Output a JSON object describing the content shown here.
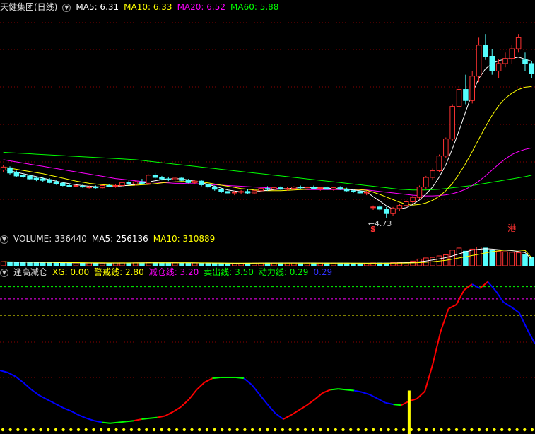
{
  "colors": {
    "up": "#ff3232",
    "down": "#54ffff",
    "ma5": "#ffffff",
    "ma10": "#ffff00",
    "ma20": "#ff00ff",
    "ma60": "#00ff00",
    "grid": "#8b0000",
    "xg_up": "#ff0000",
    "xg_down": "#0000ff",
    "xg_flat": "#00ff00"
  },
  "price_panel": {
    "title": "天健集团(日线)",
    "ma5": "MA5: 6.31",
    "ma10": "MA10: 6.33",
    "ma20": "MA20: 6.52",
    "ma60": "MA60: 5.88",
    "low_label": "←4.73",
    "marker_s": "S",
    "marker_gang": "港"
  },
  "volume_panel": {
    "volume": "VOLUME: 336440",
    "ma5": "MA5: 256136",
    "ma10": "MA10: 310889"
  },
  "indicator_panel": {
    "name": "逢高减仓",
    "xg": "XG: 0.00",
    "warn": "警戒线: 2.80",
    "reduce": "减仓线: 3.20",
    "sell": "卖出线: 3.50",
    "power": "动力线: 0.29",
    "extra": "0.29"
  },
  "chart_data": {
    "type": "candlestick",
    "title": "天健集团(日线)",
    "candles": [
      [
        6.02,
        6.15,
        5.96,
        6.1
      ],
      [
        6.08,
        6.12,
        5.9,
        5.94
      ],
      [
        5.96,
        6.0,
        5.82,
        5.86
      ],
      [
        5.88,
        5.94,
        5.8,
        5.84
      ],
      [
        5.86,
        5.9,
        5.76,
        5.78
      ],
      [
        5.8,
        5.84,
        5.72,
        5.76
      ],
      [
        5.78,
        5.82,
        5.7,
        5.74
      ],
      [
        5.76,
        5.8,
        5.66,
        5.68
      ],
      [
        5.7,
        5.74,
        5.62,
        5.64
      ],
      [
        5.66,
        5.7,
        5.58,
        5.6
      ],
      [
        5.6,
        5.66,
        5.56,
        5.58
      ],
      [
        5.58,
        5.64,
        5.54,
        5.6
      ],
      [
        5.58,
        5.62,
        5.54,
        5.56
      ],
      [
        5.56,
        5.6,
        5.52,
        5.56
      ],
      [
        5.56,
        5.6,
        5.52,
        5.54
      ],
      [
        5.54,
        5.62,
        5.52,
        5.6
      ],
      [
        5.6,
        5.64,
        5.56,
        5.58
      ],
      [
        5.58,
        5.64,
        5.54,
        5.6
      ],
      [
        5.6,
        5.7,
        5.58,
        5.68
      ],
      [
        5.68,
        5.74,
        5.6,
        5.64
      ],
      [
        5.64,
        5.72,
        5.6,
        5.7
      ],
      [
        5.7,
        5.78,
        5.64,
        5.66
      ],
      [
        5.66,
        5.9,
        5.62,
        5.88
      ],
      [
        5.88,
        5.94,
        5.78,
        5.82
      ],
      [
        5.82,
        5.86,
        5.74,
        5.78
      ],
      [
        5.78,
        5.84,
        5.72,
        5.76
      ],
      [
        5.76,
        5.82,
        5.7,
        5.8
      ],
      [
        5.8,
        5.84,
        5.72,
        5.74
      ],
      [
        5.74,
        5.78,
        5.66,
        5.68
      ],
      [
        5.68,
        5.76,
        5.64,
        5.72
      ],
      [
        5.72,
        5.76,
        5.58,
        5.62
      ],
      [
        5.62,
        5.66,
        5.52,
        5.56
      ],
      [
        5.56,
        5.6,
        5.46,
        5.5
      ],
      [
        5.5,
        5.54,
        5.4,
        5.44
      ],
      [
        5.44,
        5.5,
        5.36,
        5.4
      ],
      [
        5.4,
        5.46,
        5.34,
        5.42
      ],
      [
        5.42,
        5.48,
        5.36,
        5.44
      ],
      [
        5.44,
        5.5,
        5.38,
        5.4
      ],
      [
        5.4,
        5.48,
        5.36,
        5.46
      ],
      [
        5.46,
        5.54,
        5.42,
        5.52
      ],
      [
        5.52,
        5.58,
        5.46,
        5.5
      ],
      [
        5.5,
        5.56,
        5.46,
        5.54
      ],
      [
        5.54,
        5.58,
        5.48,
        5.5
      ],
      [
        5.5,
        5.56,
        5.46,
        5.52
      ],
      [
        5.52,
        5.58,
        5.48,
        5.56
      ],
      [
        5.56,
        5.6,
        5.5,
        5.54
      ],
      [
        5.54,
        5.58,
        5.5,
        5.56
      ],
      [
        5.56,
        5.6,
        5.5,
        5.52
      ],
      [
        5.52,
        5.56,
        5.46,
        5.54
      ],
      [
        5.54,
        5.58,
        5.48,
        5.5
      ],
      [
        5.5,
        5.56,
        5.46,
        5.54
      ],
      [
        5.54,
        5.58,
        5.48,
        5.5
      ],
      [
        5.5,
        5.54,
        5.44,
        5.46
      ],
      [
        5.46,
        5.5,
        5.4,
        5.44
      ],
      [
        5.44,
        5.48,
        5.36,
        5.4
      ],
      [
        5.4,
        5.46,
        5.34,
        5.42
      ],
      [
        5.0,
        5.06,
        4.94,
        5.02
      ],
      [
        5.02,
        5.08,
        4.9,
        4.96
      ],
      [
        4.96,
        5.02,
        4.73,
        4.84
      ],
      [
        4.84,
        5.02,
        4.78,
        4.98
      ],
      [
        4.98,
        5.1,
        4.92,
        5.06
      ],
      [
        5.06,
        5.2,
        5.0,
        5.16
      ],
      [
        5.16,
        5.32,
        5.1,
        5.28
      ],
      [
        5.28,
        5.6,
        5.24,
        5.56
      ],
      [
        5.56,
        5.86,
        5.5,
        5.82
      ],
      [
        5.82,
        6.06,
        5.74,
        6.0
      ],
      [
        6.0,
        6.44,
        5.96,
        6.4
      ],
      [
        6.4,
        6.9,
        6.34,
        6.86
      ],
      [
        6.86,
        7.8,
        6.8,
        7.74
      ],
      [
        7.74,
        8.3,
        7.6,
        8.2
      ],
      [
        8.2,
        8.6,
        7.8,
        7.9
      ],
      [
        7.9,
        8.7,
        7.82,
        8.56
      ],
      [
        8.56,
        9.6,
        8.4,
        9.4
      ],
      [
        9.4,
        9.7,
        9.0,
        9.1
      ],
      [
        9.1,
        9.3,
        8.6,
        8.7
      ],
      [
        8.7,
        9.02,
        8.5,
        8.9
      ],
      [
        8.9,
        9.2,
        8.8,
        9.04
      ],
      [
        9.04,
        9.4,
        8.9,
        9.3
      ],
      [
        9.3,
        9.7,
        9.2,
        9.6
      ],
      [
        9.0,
        9.2,
        8.7,
        8.9
      ],
      [
        8.9,
        8.96,
        8.5,
        8.64
      ]
    ],
    "ma5": [
      6.04,
      6.0,
      5.96,
      5.92,
      5.88,
      5.84,
      5.8,
      5.76,
      5.72,
      5.68,
      5.65,
      5.62,
      5.6,
      5.58,
      5.57,
      5.56,
      5.57,
      5.58,
      5.59,
      5.61,
      5.63,
      5.66,
      5.7,
      5.73,
      5.76,
      5.78,
      5.79,
      5.78,
      5.75,
      5.72,
      5.68,
      5.63,
      5.58,
      5.53,
      5.48,
      5.45,
      5.43,
      5.42,
      5.43,
      5.45,
      5.47,
      5.49,
      5.51,
      5.52,
      5.53,
      5.54,
      5.54,
      5.54,
      5.54,
      5.53,
      5.52,
      5.51,
      5.5,
      5.48,
      5.46,
      5.43,
      5.3,
      5.18,
      5.05,
      4.96,
      4.97,
      5.0,
      5.09,
      5.21,
      5.37,
      5.56,
      5.83,
      6.16,
      6.6,
      7.08,
      7.6,
      8.1,
      8.5,
      8.76,
      8.9,
      8.98,
      9.02,
      9.04,
      9.08,
      9.02,
      8.96
    ],
    "ma10": [
      6.1,
      6.07,
      6.04,
      6.01,
      5.98,
      5.95,
      5.92,
      5.88,
      5.84,
      5.8,
      5.76,
      5.72,
      5.69,
      5.66,
      5.64,
      5.62,
      5.61,
      5.6,
      5.6,
      5.6,
      5.61,
      5.62,
      5.63,
      5.65,
      5.67,
      5.69,
      5.7,
      5.71,
      5.71,
      5.7,
      5.69,
      5.67,
      5.64,
      5.61,
      5.58,
      5.55,
      5.52,
      5.5,
      5.48,
      5.47,
      5.46,
      5.46,
      5.46,
      5.47,
      5.48,
      5.49,
      5.5,
      5.51,
      5.52,
      5.52,
      5.52,
      5.52,
      5.51,
      5.5,
      5.49,
      5.47,
      5.42,
      5.36,
      5.29,
      5.22,
      5.15,
      5.09,
      5.07,
      5.09,
      5.13,
      5.2,
      5.31,
      5.46,
      5.66,
      5.91,
      6.2,
      6.52,
      6.86,
      7.19,
      7.5,
      7.76,
      7.96,
      8.1,
      8.2,
      8.26,
      8.28
    ],
    "ma20": [
      6.3,
      6.27,
      6.24,
      6.21,
      6.18,
      6.15,
      6.12,
      6.09,
      6.06,
      6.03,
      6.0,
      5.97,
      5.94,
      5.91,
      5.88,
      5.85,
      5.82,
      5.79,
      5.77,
      5.75,
      5.73,
      5.71,
      5.7,
      5.69,
      5.68,
      5.67,
      5.66,
      5.66,
      5.65,
      5.65,
      5.64,
      5.63,
      5.62,
      5.61,
      5.6,
      5.59,
      5.58,
      5.57,
      5.56,
      5.55,
      5.54,
      5.53,
      5.52,
      5.51,
      5.5,
      5.5,
      5.49,
      5.49,
      5.49,
      5.49,
      5.49,
      5.49,
      5.49,
      5.49,
      5.49,
      5.48,
      5.46,
      5.44,
      5.42,
      5.4,
      5.38,
      5.36,
      5.34,
      5.33,
      5.32,
      5.32,
      5.33,
      5.35,
      5.38,
      5.43,
      5.5,
      5.6,
      5.72,
      5.86,
      6.02,
      6.18,
      6.32,
      6.44,
      6.52,
      6.58,
      6.62
    ],
    "ma60": [
      6.5,
      6.49,
      6.48,
      6.47,
      6.46,
      6.45,
      6.44,
      6.43,
      6.42,
      6.41,
      6.4,
      6.39,
      6.38,
      6.37,
      6.36,
      6.35,
      6.34,
      6.33,
      6.32,
      6.31,
      6.3,
      6.28,
      6.26,
      6.24,
      6.22,
      6.2,
      6.18,
      6.16,
      6.14,
      6.12,
      6.1,
      6.08,
      6.06,
      6.04,
      6.02,
      6.0,
      5.98,
      5.96,
      5.94,
      5.92,
      5.9,
      5.88,
      5.86,
      5.84,
      5.82,
      5.8,
      5.78,
      5.76,
      5.74,
      5.72,
      5.7,
      5.68,
      5.66,
      5.64,
      5.62,
      5.6,
      5.58,
      5.56,
      5.54,
      5.52,
      5.5,
      5.49,
      5.48,
      5.48,
      5.48,
      5.49,
      5.5,
      5.52,
      5.54,
      5.56,
      5.58,
      5.6,
      5.63,
      5.66,
      5.69,
      5.72,
      5.75,
      5.78,
      5.81,
      5.84,
      5.88
    ],
    "volume": [
      160,
      150,
      140,
      135,
      130,
      128,
      126,
      120,
      118,
      115,
      112,
      110,
      108,
      106,
      104,
      102,
      104,
      108,
      112,
      110,
      114,
      112,
      130,
      120,
      115,
      112,
      116,
      110,
      106,
      108,
      104,
      100,
      98,
      96,
      94,
      92,
      96,
      98,
      100,
      104,
      106,
      108,
      104,
      106,
      108,
      106,
      104,
      102,
      104,
      100,
      102,
      100,
      98,
      96,
      94,
      96,
      110,
      104,
      100,
      120,
      130,
      150,
      180,
      260,
      300,
      320,
      380,
      420,
      600,
      680,
      560,
      640,
      720,
      680,
      600,
      560,
      540,
      520,
      500,
      420,
      336
    ],
    "volume_ma5": [
      150,
      146,
      142,
      138,
      135,
      132,
      130,
      128,
      124,
      120,
      117,
      114,
      111,
      108,
      106,
      105,
      105,
      106,
      107,
      109,
      111,
      113,
      117,
      118,
      118,
      117,
      117,
      115,
      113,
      111,
      109,
      106,
      103,
      100,
      98,
      96,
      95,
      96,
      98,
      100,
      102,
      104,
      105,
      106,
      106,
      106,
      106,
      105,
      104,
      103,
      102,
      101,
      100,
      99,
      98,
      97,
      99,
      100,
      101,
      105,
      113,
      121,
      133,
      154,
      184,
      222,
      262,
      316,
      380,
      460,
      532,
      604,
      636,
      656,
      640,
      618,
      600,
      584,
      550,
      504,
      256
    ],
    "volume_ma10": [
      155,
      152,
      149,
      146,
      143,
      140,
      138,
      135,
      132,
      129,
      126,
      123,
      120,
      117,
      115,
      113,
      112,
      111,
      111,
      111,
      112,
      112,
      114,
      115,
      116,
      116,
      116,
      116,
      115,
      114,
      112,
      110,
      108,
      106,
      104,
      102,
      101,
      100,
      100,
      100,
      100,
      100,
      100,
      101,
      102,
      103,
      104,
      104,
      104,
      104,
      104,
      103,
      102,
      101,
      100,
      99,
      99,
      99,
      99,
      100,
      102,
      106,
      112,
      122,
      137,
      157,
      181,
      213,
      254,
      300,
      348,
      396,
      440,
      492,
      540,
      578,
      604,
      610,
      606,
      586,
      310
    ]
  },
  "indicator_data": {
    "xg_levels": {
      "warn": 2.8,
      "reduce": 3.2,
      "sell": 3.5
    },
    "xg": [
      1.45,
      1.4,
      1.3,
      1.15,
      0.98,
      0.84,
      0.74,
      0.64,
      0.54,
      0.46,
      0.36,
      0.28,
      0.22,
      0.18,
      0.16,
      0.18,
      0.2,
      0.22,
      0.26,
      0.28,
      0.3,
      0.34,
      0.44,
      0.56,
      0.74,
      0.98,
      1.16,
      1.26,
      1.28,
      1.28,
      1.28,
      1.26,
      1.1,
      0.86,
      0.62,
      0.4,
      0.26,
      0.36,
      0.48,
      0.6,
      0.74,
      0.9,
      0.98,
      1.0,
      0.98,
      0.96,
      0.92,
      0.86,
      0.76,
      0.66,
      0.62,
      0.6,
      0.7,
      0.76,
      0.94,
      1.6,
      2.4,
      2.96,
      3.06,
      3.42,
      3.56,
      3.46,
      3.62,
      3.4,
      3.12,
      3.0,
      2.86,
      2.46,
      2.1
    ]
  }
}
